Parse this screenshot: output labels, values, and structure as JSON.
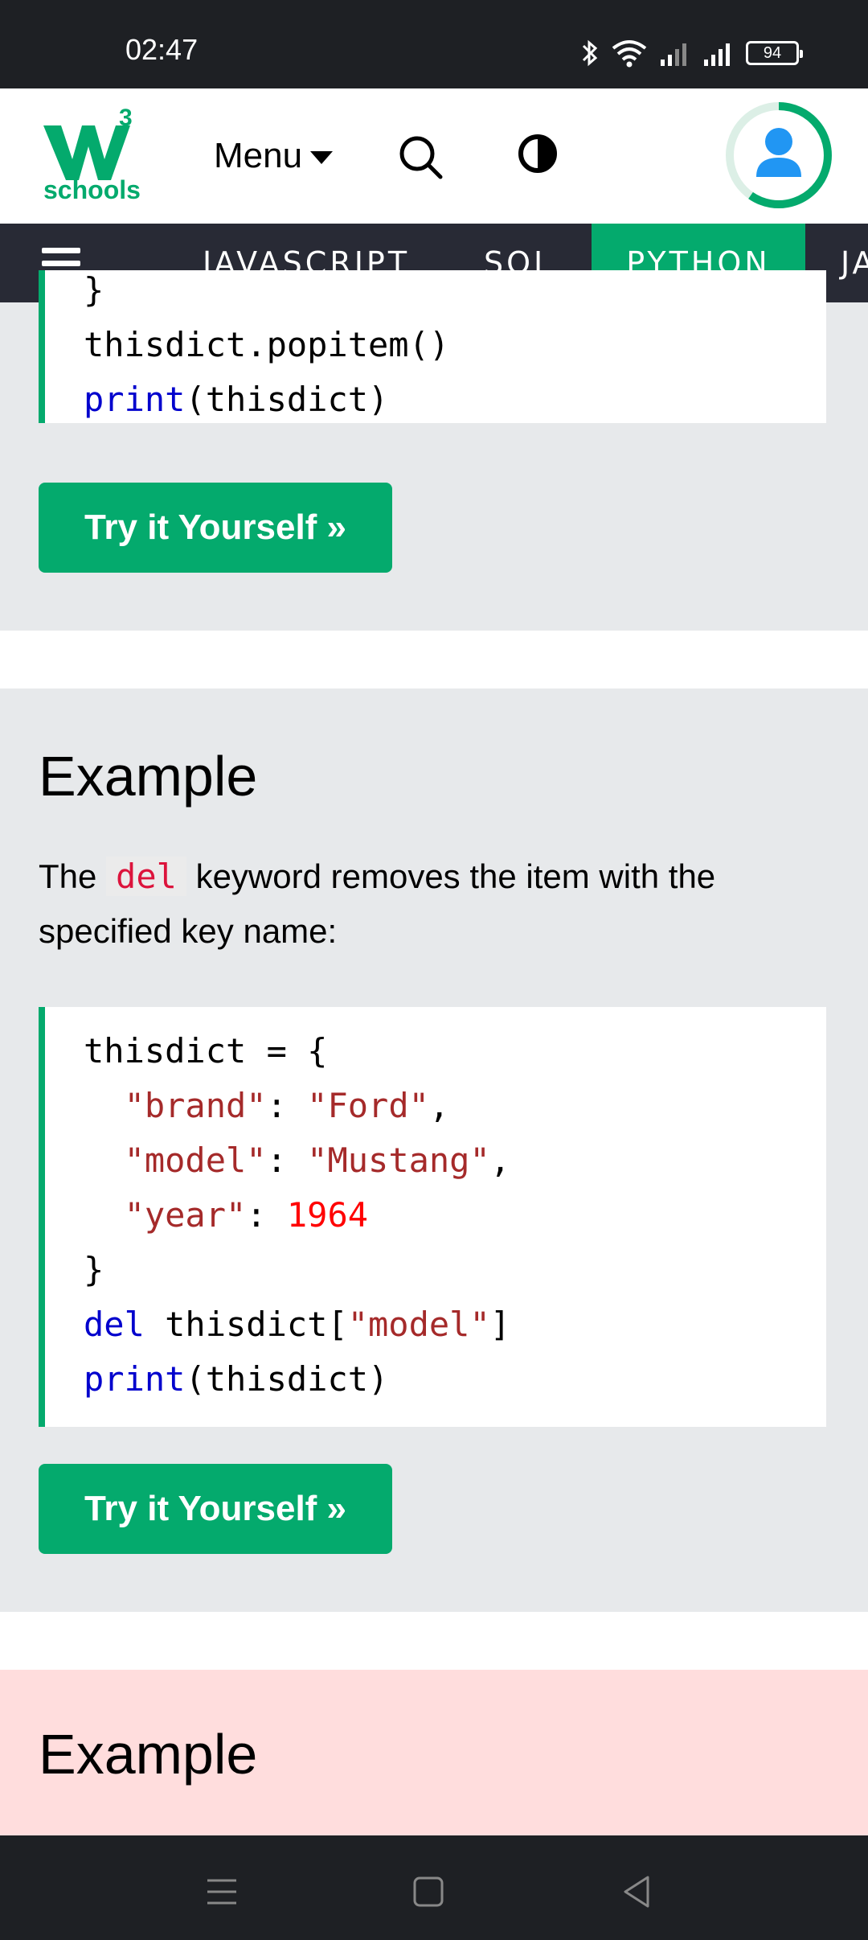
{
  "status_bar": {
    "time": "02:47",
    "battery": "94"
  },
  "header": {
    "logo_text": "schools",
    "logo_superscript": "3",
    "menu_label": "Menu",
    "accent_color": "#04aa6d"
  },
  "topnav": {
    "items": [
      {
        "label": "JAVASCRIPT"
      },
      {
        "label": "SQL"
      },
      {
        "label": "PYTHON"
      },
      {
        "label": "JA"
      }
    ],
    "active": "PYTHON"
  },
  "example_top": {
    "code": [
      "}",
      "thisdict.popitem()",
      "print(thisdict)"
    ],
    "button_label": "Try it Yourself »"
  },
  "example_del": {
    "title": "Example",
    "desc_before": "The ",
    "desc_code": "del",
    "desc_after": " keyword removes the item with the specified key name:",
    "code": {
      "line1": "thisdict = {",
      "brand_key": "\"brand\"",
      "brand_val": "\"Ford\"",
      "model_key": "\"model\"",
      "model_val": "\"Mustang\"",
      "year_key": "\"year\"",
      "year_val": "1964",
      "close": "}",
      "del_kw": "del",
      "del_target": " thisdict[",
      "del_key": "\"model\"",
      "del_close": "]",
      "print_kw": "print",
      "print_arg": "(thisdict)"
    },
    "button_label": "Try it Yourself »"
  },
  "example_next": {
    "title": "Example"
  },
  "system_nav": {
    "icons": [
      "menu-icon",
      "home-icon",
      "back-icon"
    ]
  }
}
